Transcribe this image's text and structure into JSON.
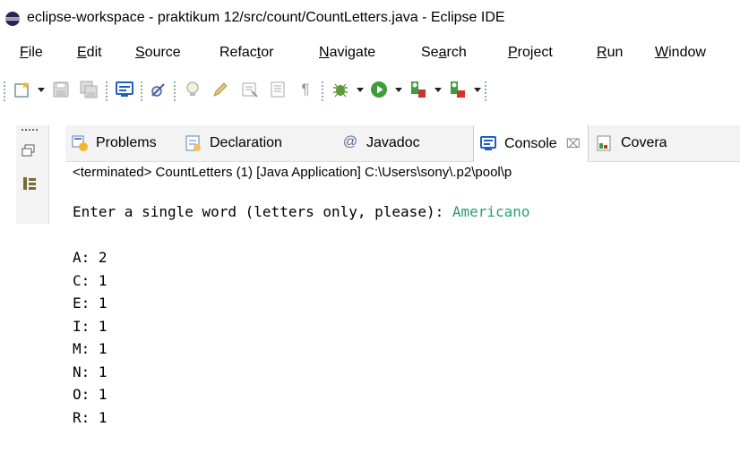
{
  "window": {
    "title": "eclipse-workspace - praktikum 12/src/count/CountLetters.java - Eclipse IDE"
  },
  "menu": [
    {
      "mnemonic": "F",
      "rest": "ile"
    },
    {
      "mnemonic": "E",
      "rest": "dit"
    },
    {
      "mnemonic": "S",
      "rest": "ource"
    },
    {
      "pre": "Refac",
      "mnemonic": "t",
      "rest": "or"
    },
    {
      "mnemonic": "N",
      "rest": "avigate"
    },
    {
      "pre": "Se",
      "mnemonic": "a",
      "rest": "rch"
    },
    {
      "mnemonic": "P",
      "rest": "roject"
    },
    {
      "mnemonic": "R",
      "rest": "un"
    },
    {
      "mnemonic": "W",
      "rest": "indow"
    }
  ],
  "toolbar_icons": [
    "new-icon",
    "save-icon",
    "save-all-icon",
    "terminal-icon",
    "skip-breakpoints-icon",
    "tip-icon",
    "edit-icon",
    "view-icon",
    "view2-icon",
    "pilcrow-icon",
    "debug-icon",
    "run-icon",
    "coverage-icon",
    "external-tools-icon"
  ],
  "tabs": [
    {
      "label": "Problems",
      "icon": "problems-icon"
    },
    {
      "label": "Declaration",
      "icon": "declaration-icon"
    },
    {
      "label": "Javadoc",
      "icon": "javadoc-icon"
    },
    {
      "label": "Console",
      "icon": "console-icon",
      "active": true,
      "close": "⌧"
    },
    {
      "label": "Covera",
      "icon": "coverage-icon"
    }
  ],
  "console": {
    "status": "<terminated> CountLetters (1) [Java Application] C:\\Users\\sony\\.p2\\pool\\p",
    "prompt": "Enter a single word (letters only, please): ",
    "user_input": "Americano",
    "lines": [
      "A: 2",
      "C: 1",
      "E: 1",
      "I: 1",
      "M: 1",
      "N: 1",
      "O: 1",
      "R: 1"
    ]
  },
  "colors": {
    "input_text": "#2aa06b",
    "tab_bar": "#f3f3f3",
    "accent": "#1f5fbf"
  }
}
